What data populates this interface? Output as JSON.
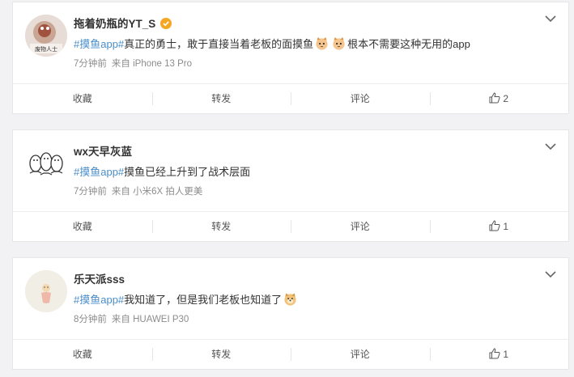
{
  "colors": {
    "hashtag": "#4a8ec9",
    "meta": "#8c8c8c",
    "verified": "#f5a623",
    "page_bg": "#f2f2f5"
  },
  "posts": [
    {
      "user": "拖着奶瓶的YT_S",
      "verified": true,
      "avatar_text": "废物人士",
      "hashtag": "#摸鱼app#",
      "text": "真正的勇士，敢于直接当着老板的面摸鱼",
      "text_after": "根本不需要这种无用的app",
      "time": "7分钟前",
      "source": "来自 iPhone 13 Pro",
      "actions": {
        "collect": "收藏",
        "repost": "转发",
        "comment": "评论",
        "likes": "2"
      }
    },
    {
      "user": "wx天早灰蓝",
      "verified": false,
      "hashtag": "#摸鱼app#",
      "text": "摸鱼已经上升到了战术层面",
      "time": "7分钟前",
      "source": "来自 小米6X 拍人更美",
      "actions": {
        "collect": "收藏",
        "repost": "转发",
        "comment": "评论",
        "likes": "1"
      }
    },
    {
      "user": "乐天派sss",
      "verified": false,
      "hashtag": "#摸鱼app#",
      "text": "我知道了，但是我们老板也知道了",
      "time": "8分钟前",
      "source": "来自 HUAWEI P30",
      "actions": {
        "collect": "收藏",
        "repost": "转发",
        "comment": "评论",
        "likes": "1"
      }
    }
  ]
}
